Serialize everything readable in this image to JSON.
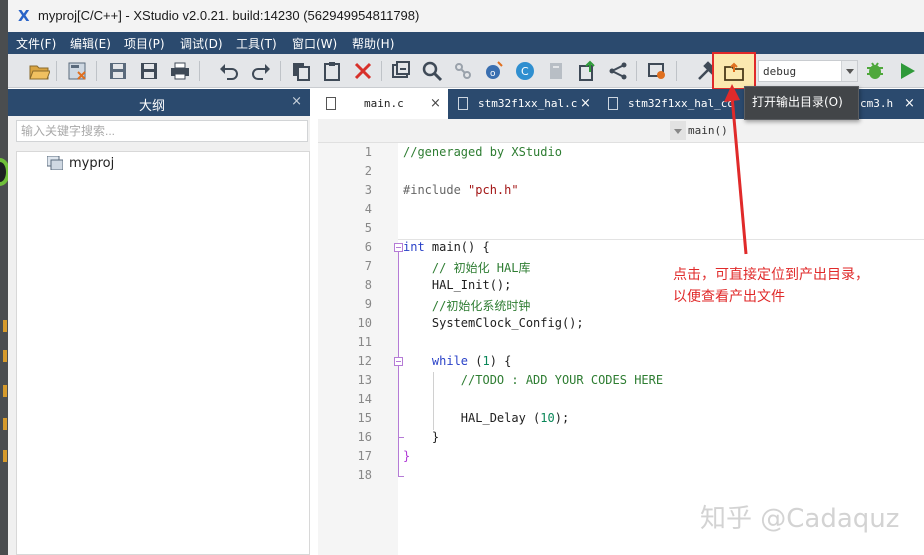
{
  "window": {
    "app_logo": "X",
    "title": "myproj[C/C++] - XStudio v2.0.21. build:14230 (562949954811798)"
  },
  "menu": [
    "文件(F)",
    "编辑(E)",
    "项目(P)",
    "调试(D)",
    "工具(T)",
    "窗口(W)",
    "帮助(H)"
  ],
  "toolbar": {
    "build_config": "debug",
    "tooltip": "打开输出目录(O)"
  },
  "outline": {
    "title": "大纲",
    "close": "×",
    "search_placeholder": "输入关键字搜索...",
    "tree": [
      {
        "label": "myproj"
      }
    ]
  },
  "tabs": [
    {
      "label": "main.c",
      "active": true,
      "close": "×"
    },
    {
      "label": "stm32f1xx_hal.c",
      "active": false,
      "close": "×"
    },
    {
      "label": "stm32f1xx_hal_co",
      "active": false,
      "close": ""
    },
    {
      "label": "cm3.h",
      "active": false,
      "close": "×"
    }
  ],
  "editor": {
    "function_selector": "main()",
    "lines": [
      {
        "n": "1",
        "text": "//generaged by XStudio"
      },
      {
        "n": "2",
        "text": ""
      },
      {
        "n": "3",
        "text": "#include \"pch.h\""
      },
      {
        "n": "4",
        "text": ""
      },
      {
        "n": "5",
        "text": ""
      },
      {
        "n": "6",
        "text": "int main() {"
      },
      {
        "n": "7",
        "text": "    // 初始化 HAL库"
      },
      {
        "n": "8",
        "text": "    HAL_Init();"
      },
      {
        "n": "9",
        "text": "    //初始化系统时钟"
      },
      {
        "n": "10",
        "text": "    SystemClock_Config();"
      },
      {
        "n": "11",
        "text": ""
      },
      {
        "n": "12",
        "text": "    while (1) {"
      },
      {
        "n": "13",
        "text": "        //TODO : ADD YOUR CODES HERE"
      },
      {
        "n": "14",
        "text": ""
      },
      {
        "n": "15",
        "text": "        HAL_Delay (10);"
      },
      {
        "n": "16",
        "text": "    }"
      },
      {
        "n": "17",
        "text": "}"
      },
      {
        "n": "18",
        "text": ""
      }
    ]
  },
  "annotation": {
    "line1": "点击，可直接定位到产出目录，",
    "line2": "以便查看产出文件",
    "color": "#e02a2a"
  },
  "watermark": "知乎 @Cadaquz",
  "colors": {
    "menu_bg": "#2b4a6e",
    "toolbar_bg": "#e4e6e9",
    "highlight_border": "#e02a2a",
    "comment": "#2e7d32",
    "keyword": "#2a42c8",
    "string": "#a31515",
    "number": "#098658"
  },
  "toolbar_icons": [
    "open-folder-icon",
    "close-project-icon",
    "save-icon",
    "save-all-icon",
    "print-icon",
    "undo-icon",
    "redo-icon",
    "copy-icon",
    "paste-icon",
    "delete-icon",
    "refresh-icon",
    "search-icon",
    "link-icon",
    "object-icon",
    "c-icon",
    "document-icon",
    "export-icon",
    "share-icon",
    "settings-icon",
    "tools-icon",
    "open-output-dir-icon",
    "debug-bug-icon",
    "run-icon"
  ]
}
